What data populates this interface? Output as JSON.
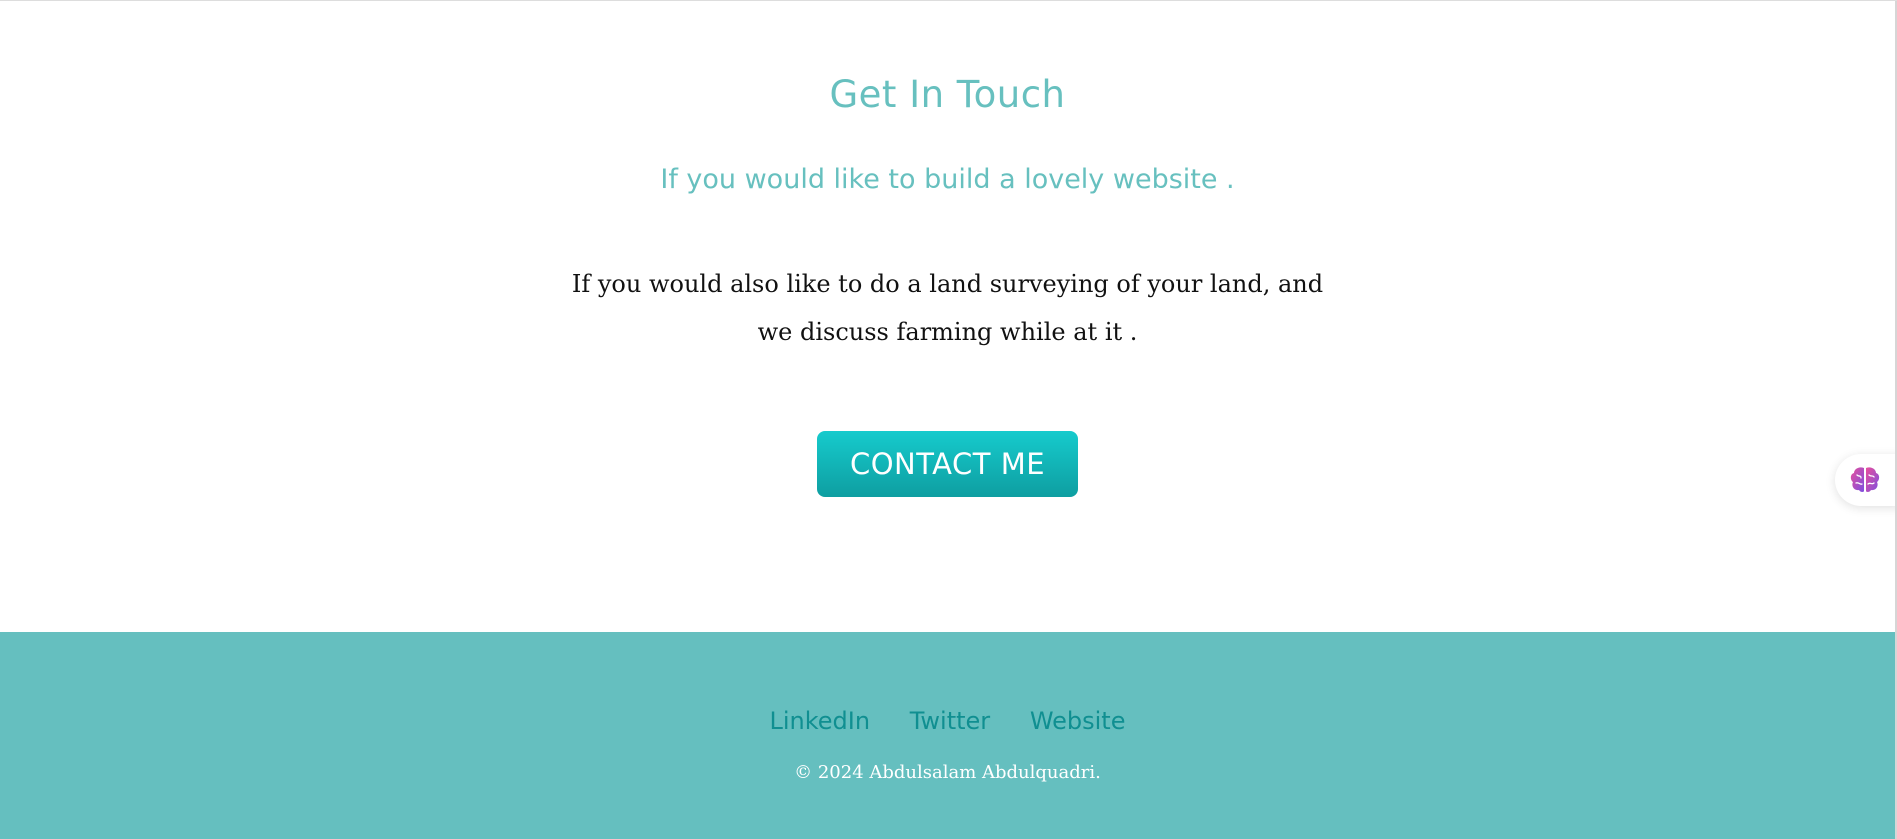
{
  "contact_section": {
    "title": "Get In Touch",
    "subtitle": "If you would like to build a lovely website .",
    "body": "If you would also like to do a land surveying of your land, and we discuss farming while at it .",
    "button_label": "CONTACT ME"
  },
  "side_widget": {
    "icon": "brain-icon"
  },
  "footer": {
    "links": [
      {
        "label": "LinkedIn"
      },
      {
        "label": "Twitter"
      },
      {
        "label": "Website"
      }
    ],
    "copyright": "© 2024 Abdulsalam Abdulquadri."
  },
  "colors": {
    "accent": "#67c0bf",
    "button_top": "#16cbcd",
    "button_bottom": "#0e9ea1",
    "footer_bg": "#65bfbf",
    "footer_link": "#108f91"
  }
}
